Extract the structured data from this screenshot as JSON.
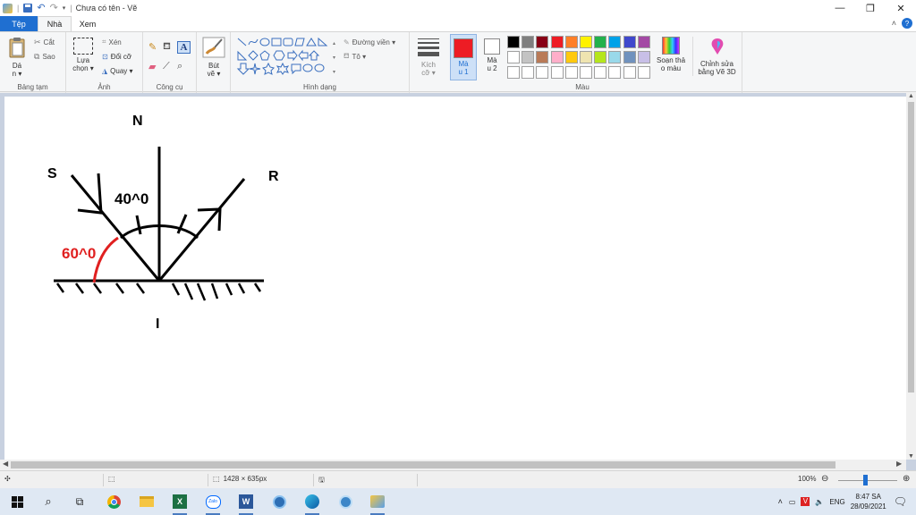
{
  "window": {
    "title": "Chưa có tên - Vẽ",
    "minimize": "—",
    "restore": "❐",
    "close": "✕"
  },
  "tabs": {
    "file": "Tệp",
    "home": "Nhà",
    "view": "Xem",
    "collapse": "˄",
    "help": "?"
  },
  "ribbon": {
    "clipboard": {
      "label": "Bảng tạm",
      "paste": "Dá",
      "paste2": "n ▾",
      "cut": "Cắt",
      "copy": "Sao"
    },
    "image": {
      "label": "Ảnh",
      "select": "Lựa",
      "select2": "chọn ▾",
      "crop": "Xén",
      "resize": "Đổi cỡ",
      "rotate": "Quay ▾"
    },
    "tools": {
      "label": "Công cụ"
    },
    "brushes": {
      "label": "Bút",
      "label2": "vẽ ▾"
    },
    "shapes": {
      "label": "Hình dạng",
      "outline": "Đường viền ▾",
      "fill": "Tô ▾"
    },
    "size": {
      "label": "Kích",
      "label2": "cỡ ▾"
    },
    "color1": {
      "label": "Mà",
      "label2": "u 1"
    },
    "color2": {
      "label": "Mà",
      "label2": "u 2"
    },
    "colors": {
      "label": "Màu",
      "row1": [
        "#000000",
        "#7f7f7f",
        "#880015",
        "#ed1c24",
        "#ff7f27",
        "#fff200",
        "#22b14c",
        "#00a2e8",
        "#3f48cc",
        "#a349a4"
      ],
      "row2": [
        "#ffffff",
        "#c3c3c3",
        "#b97a57",
        "#ffaec9",
        "#ffc90e",
        "#efe4b0",
        "#b5e61d",
        "#99d9ea",
        "#7092be",
        "#c8bfe7"
      ],
      "row3": [
        "#ffffff",
        "#ffffff",
        "#ffffff",
        "#ffffff",
        "#ffffff",
        "#ffffff",
        "#ffffff",
        "#ffffff",
        "#ffffff",
        "#ffffff"
      ]
    },
    "edit_colors": {
      "label": "Soạn thả",
      "label2": "o màu"
    },
    "paint3d": {
      "label": "Chỉnh sửa",
      "label2": "bằng Vẽ 3D"
    }
  },
  "drawing": {
    "label_N": "N",
    "label_S": "S",
    "label_R": "R",
    "label_I": "I",
    "angle_reflect": "40^0",
    "angle_incident": "60^0",
    "red": "#e02020"
  },
  "status": {
    "cursor_icon": "✣",
    "selection_icon": "⬚",
    "canvas_size": "1428 × 635px",
    "disk_icon": "🖫",
    "zoom": "100%",
    "zoom_out": "⊖",
    "zoom_in": "⊕"
  },
  "taskbar": {
    "lang": "ENG",
    "time": "8:47 SA",
    "date": "28/09/2021"
  }
}
